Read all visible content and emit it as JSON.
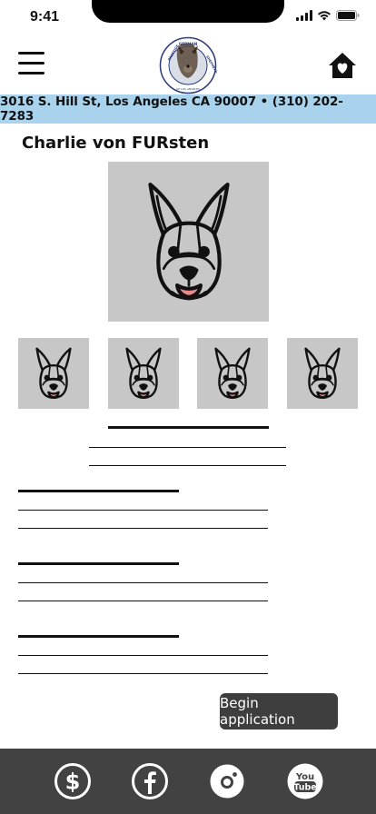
{
  "status_bar": {
    "time": "9:41"
  },
  "header": {
    "menu_icon": "hamburger-menu-icon",
    "logo": "prestige-german-shepherd-rescue-logo",
    "logo_text": "PRESTIGE GERMAN SHEPHERD RESCUE OF LOS ANGELES",
    "home_icon": "house-heart-icon"
  },
  "address_bar": {
    "text": "3016 S. Hill St, Los Angeles CA 90007 • (310) 202-7283"
  },
  "dog": {
    "name": "Charlie von FURsten",
    "main_photo_icon": "german-shepherd-face-icon",
    "thumbnails": [
      "german-shepherd-face-icon",
      "german-shepherd-face-icon",
      "german-shepherd-face-icon",
      "german-shepherd-face-icon"
    ]
  },
  "actions": {
    "begin_application": "Begin application"
  },
  "bottom_nav": {
    "items": [
      "dollar-icon",
      "facebook-icon",
      "instagram-icon",
      "youtube-icon"
    ],
    "youtube_text": "You Tube"
  },
  "colors": {
    "banner": "#a9d3ed",
    "photo_placeholder": "#c7c7c7",
    "button": "#3e3e3e",
    "bottom_nav": "#424242",
    "tongue": "#e88a8a"
  }
}
